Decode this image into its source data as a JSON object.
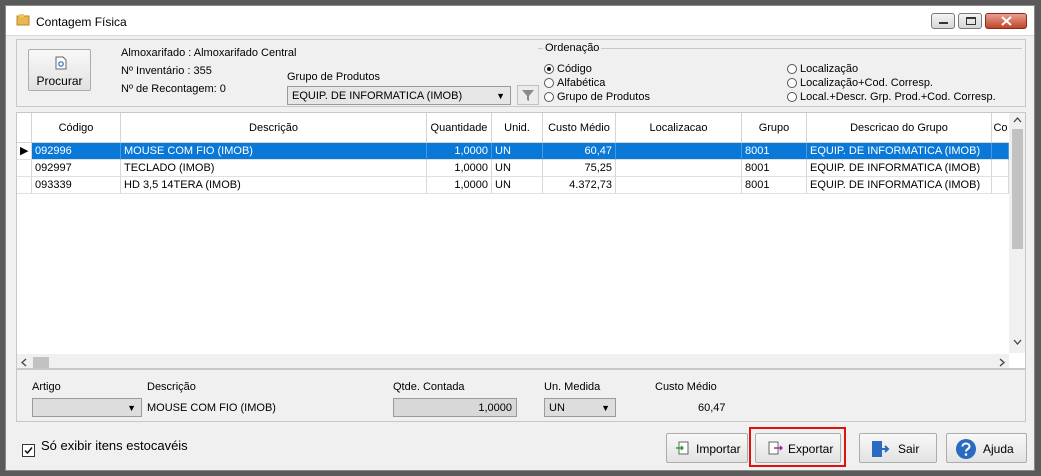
{
  "window": {
    "title": "Contagem Física"
  },
  "toolbar": {
    "procurar_label": "Procurar",
    "almoxarifado": "Almoxarifado : Almoxarifado Central",
    "inventario": "Nº Inventário : 355",
    "recontagem": "Nº de Recontagem: 0",
    "grupo_label": "Grupo de Produtos",
    "grupo_value": "EQUIP. DE INFORMATICA (IMOB)"
  },
  "ordenacao": {
    "title": "Ordenação",
    "options": [
      "Código",
      "Alfabética",
      "Grupo de Produtos",
      "Localização",
      "Localização+Cod. Corresp.",
      "Local.+Descr. Grp. Prod.+Cod. Corresp."
    ],
    "selected": "Código"
  },
  "grid": {
    "columns": [
      "Código",
      "Descrição",
      "Quantidade",
      "Unid.",
      "Custo Médio",
      "Localizacao",
      "Grupo",
      "Descricao do Grupo",
      "Co"
    ],
    "rows": [
      {
        "codigo": "092996",
        "descricao": "MOUSE COM FIO (IMOB)",
        "quantidade": "1,0000",
        "unid": "UN",
        "custo": "60,47",
        "localizacao": "",
        "grupo": "8001",
        "desc_grupo": "EQUIP. DE INFORMATICA (IMOB)"
      },
      {
        "codigo": "092997",
        "descricao": "TECLADO (IMOB)",
        "quantidade": "1,0000",
        "unid": "UN",
        "custo": "75,25",
        "localizacao": "",
        "grupo": "8001",
        "desc_grupo": "EQUIP. DE INFORMATICA (IMOB)"
      },
      {
        "codigo": "093339",
        "descricao": "HD 3,5 14TERA (IMOB)",
        "quantidade": "1,0000",
        "unid": "UN",
        "custo": "4.372,73",
        "localizacao": "",
        "grupo": "8001",
        "desc_grupo": "EQUIP. DE INFORMATICA (IMOB)"
      }
    ]
  },
  "detail": {
    "artigo_label": "Artigo",
    "artigo_value": "",
    "descricao_label": "Descrição",
    "descricao_value": "MOUSE COM FIO (IMOB)",
    "qtde_label": "Qtde. Contada",
    "qtde_value": "1,0000",
    "um_label": "Un. Medida",
    "um_value": "UN",
    "custo_label": "Custo Médio",
    "custo_value": "60,47"
  },
  "footer": {
    "estocaveis_label": "Só exibir itens estocavéis",
    "estocaveis_checked": true,
    "importar_label": "Importar",
    "exportar_label": "Exportar",
    "sair_label": "Sair",
    "ajuda_label": "Ajuda"
  },
  "colors": {
    "selection": "#0a78d7",
    "highlight_border": "#e01010"
  }
}
